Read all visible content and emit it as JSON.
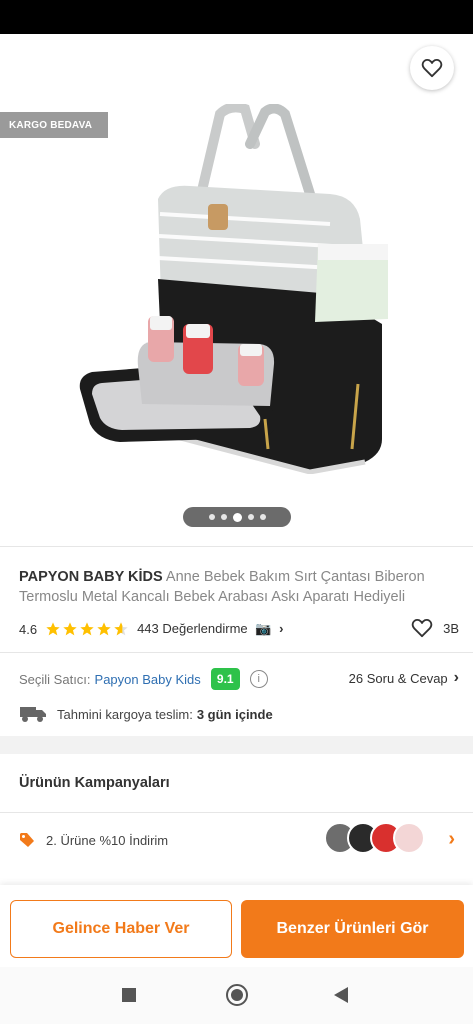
{
  "header": {
    "back_icon": "arrow-left-icon",
    "share_icon": "share-icon",
    "favorite_icon": "heart-outline-icon"
  },
  "badge": {
    "label": "KARGO BEDAVA"
  },
  "gallery": {
    "image_count": 5,
    "active_index": 2
  },
  "product": {
    "brand": "PAPYON BABY KİDS",
    "name": "Anne Bebek Bakım Sırt Çantası Biberon Termoslu Metal Kancalı Bebek Arabası Askı Aparatı Hediyeli",
    "rating": "4.6",
    "rating_stars": 4.6,
    "review_count": "443 Değerlendirme",
    "favorite_count": "3B"
  },
  "seller": {
    "label": "Seçili Satıcı:",
    "name": "Papyon Baby Kids",
    "score": "9.1",
    "qa": "26 Soru & Cevap"
  },
  "delivery": {
    "label": "Tahmini kargoya teslim:",
    "value": "3 gün içinde"
  },
  "campaigns": {
    "title": "Ürünün Kampanyaları",
    "items": [
      {
        "label": "2. Ürüne %10 İndirim"
      }
    ]
  },
  "actions": {
    "notify_label": "Gelince Haber Ver",
    "similar_label": "Benzer Ürünleri Gör"
  },
  "colors": {
    "accent": "#f27a1a",
    "score": "#2ec24a",
    "seller_link": "#2f6fb2"
  }
}
